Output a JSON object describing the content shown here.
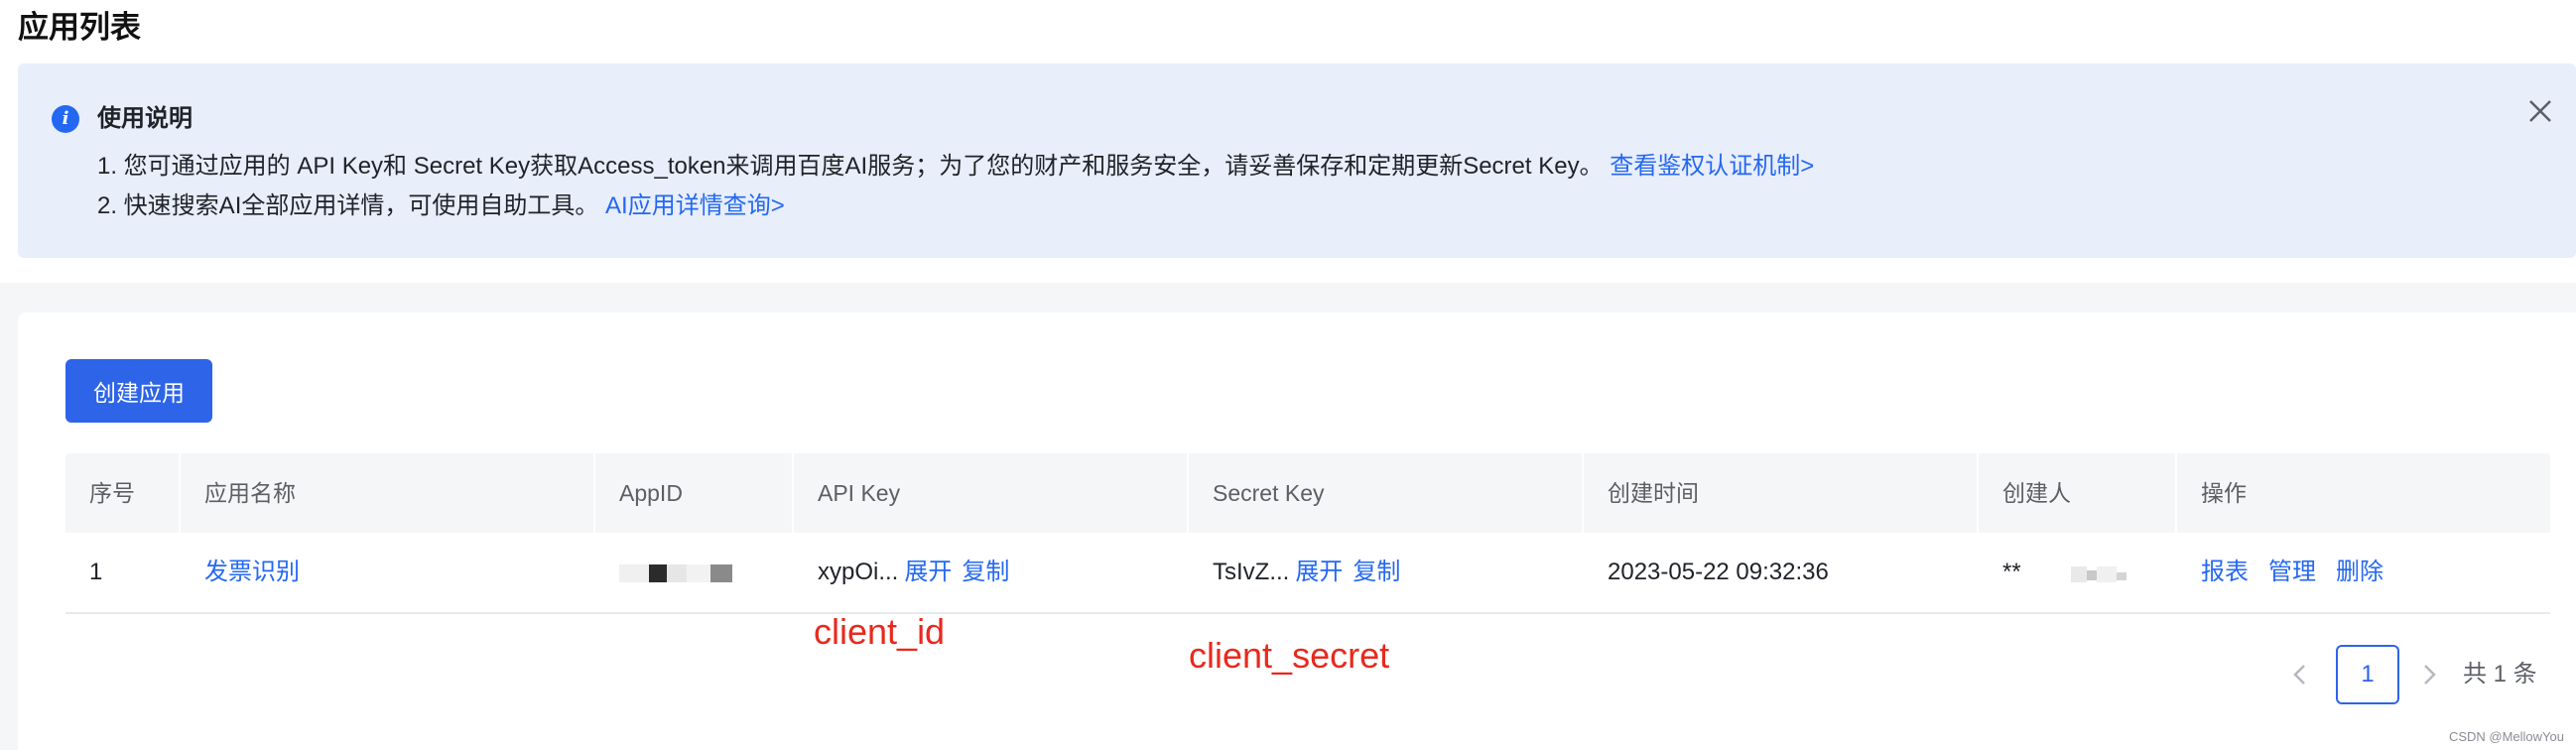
{
  "page": {
    "title": "应用列表"
  },
  "notice": {
    "title": "使用说明",
    "line1_text": "1. 您可通过应用的 API Key和 Secret Key获取Access_token来调用百度AI服务；为了您的财产和服务安全，请妥善保存和定期更新Secret Key。",
    "line1_link": "查看鉴权认证机制>",
    "line2_text": "2. 快速搜索AI全部应用详情，可使用自助工具。",
    "line2_link": "AI应用详情查询>"
  },
  "create_button": "创建应用",
  "table": {
    "headers": [
      "序号",
      "应用名称",
      "AppID",
      "API Key",
      "Secret Key",
      "创建时间",
      "创建人",
      "操作"
    ],
    "rows": [
      {
        "index": "1",
        "name": "发票识别",
        "api_key": "xypOi...",
        "secret_key": "TsIvZ...",
        "created_at": "2023-05-22 09:32:36",
        "creator": "**",
        "expand_label": "展开",
        "copy_label": "复制",
        "actions": [
          "报表",
          "管理",
          "删除"
        ]
      }
    ]
  },
  "annotations": {
    "client_id": "client_id",
    "client_secret": "client_secret"
  },
  "pagination": {
    "current_page": "1",
    "total": "共 1 条"
  },
  "watermark": "CSDN @MellowYou",
  "colors": {
    "primary": "#2468f2",
    "button": "#2d64e8",
    "notice_bg": "#e8eefa",
    "annotation": "#e8291e"
  }
}
